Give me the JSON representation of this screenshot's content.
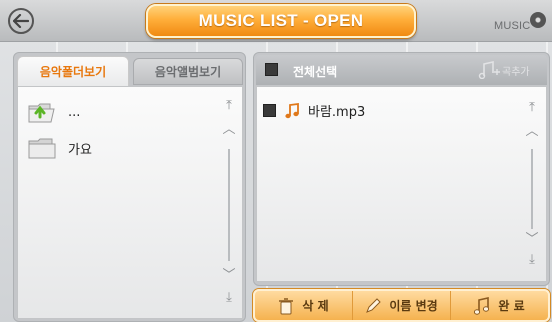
{
  "header": {
    "title": "MUSIC LIST - OPEN",
    "music_button_label": "MUSIC",
    "back_icon": "back-arrow-icon"
  },
  "left_panel": {
    "tabs": [
      {
        "label": "음악폴더보기",
        "active": true
      },
      {
        "label": "음악앨범보기",
        "active": false
      }
    ],
    "items": [
      {
        "label": "...",
        "icon": "folder-up-icon"
      },
      {
        "label": "가요",
        "icon": "folder-icon"
      }
    ]
  },
  "right_panel": {
    "select_all_label": "전체선택",
    "add_track_label": "곡추가",
    "items": [
      {
        "label": "바람.mp3",
        "icon": "music-note-icon"
      }
    ]
  },
  "actions": [
    {
      "label": "삭 제",
      "icon": "trash-icon"
    },
    {
      "label": "이름 변경",
      "icon": "pencil-icon"
    },
    {
      "label": "완 료",
      "icon": "music-note-icon"
    }
  ],
  "colors": {
    "accent": "#f08a12",
    "tab_active_text": "#e8780e"
  }
}
